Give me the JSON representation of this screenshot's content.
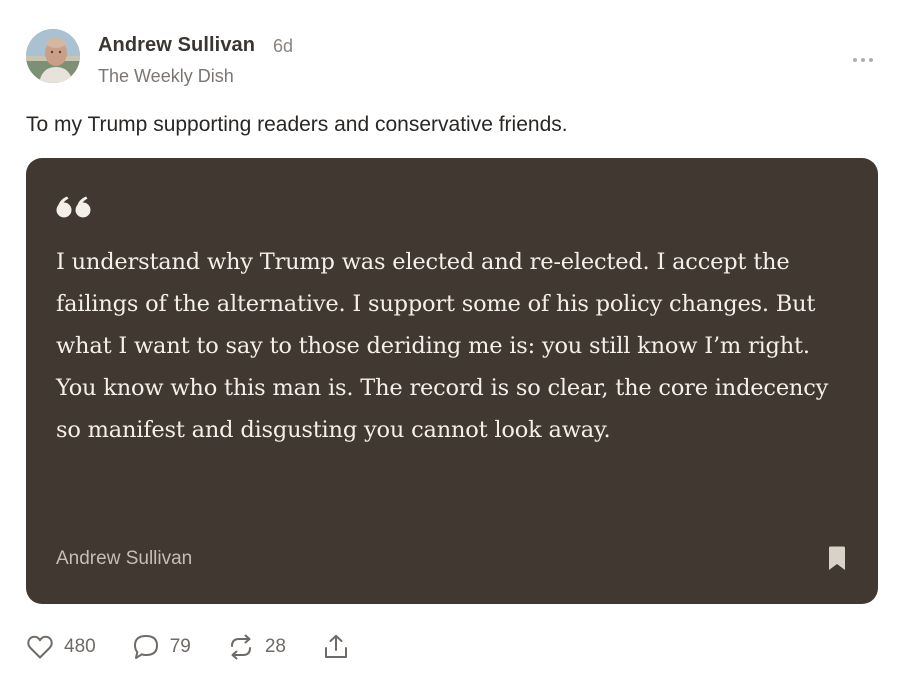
{
  "author": {
    "name": "Andrew Sullivan",
    "age": "6d",
    "publication": "The Weekly Dish",
    "avatar_icon": "author-avatar-photo"
  },
  "post": {
    "text": "To my Trump supporting readers and conservative friends."
  },
  "quote": {
    "icon": "quote-mark-icon",
    "body": "I understand why Trump was elected and re-elected. I accept the failings of the alternative. I support some of his policy changes. But what I want to say to those deriding me is: you still know I’m right. You know who this man is. The record is so clear, the core indecency so manifest and disgusting you cannot look away.",
    "attribution": "Andrew Sullivan",
    "bookmark_icon": "bookmark-icon"
  },
  "actions": {
    "likes": "480",
    "comments": "79",
    "restacks": "28",
    "share_icon": "share-icon"
  },
  "colors": {
    "card_background": "#403831",
    "quote_text": "#f4efe8",
    "attribution_text": "#c6beb4",
    "author_name": "#3a3632",
    "muted_text": "#7b7671"
  }
}
